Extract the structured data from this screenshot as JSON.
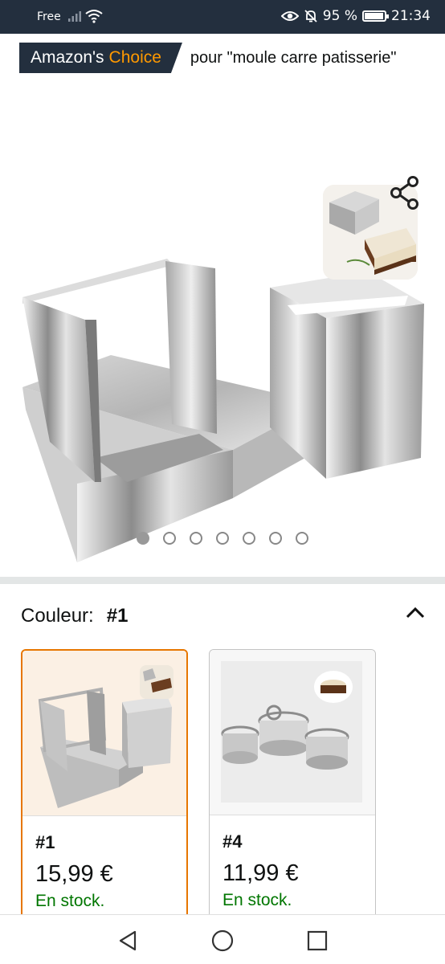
{
  "status_bar": {
    "carrier": "Free",
    "battery": "95 %",
    "battery_level": 0.95,
    "time": "21:34",
    "icons": [
      "signal-icon",
      "wifi-icon",
      "eye-icon",
      "bell-off-icon",
      "battery-icon"
    ]
  },
  "choice_badge": {
    "brand": "Amazon's",
    "accent": "Choice",
    "query": "pour \"moule carre patisserie\""
  },
  "gallery": {
    "image_count": 7,
    "active_index": 0
  },
  "variation": {
    "label": "Couleur:",
    "value": "#1"
  },
  "options": [
    {
      "name": "#1",
      "price": "15,99 €",
      "stock": "En stock.",
      "selected": true
    },
    {
      "name": "#4",
      "price": "11,99 €",
      "stock": "En stock.",
      "selected": false
    }
  ],
  "colors": {
    "header": "#232f3e",
    "accent": "#ff9900",
    "in_stock": "#007600",
    "selected_border": "#e77600"
  }
}
